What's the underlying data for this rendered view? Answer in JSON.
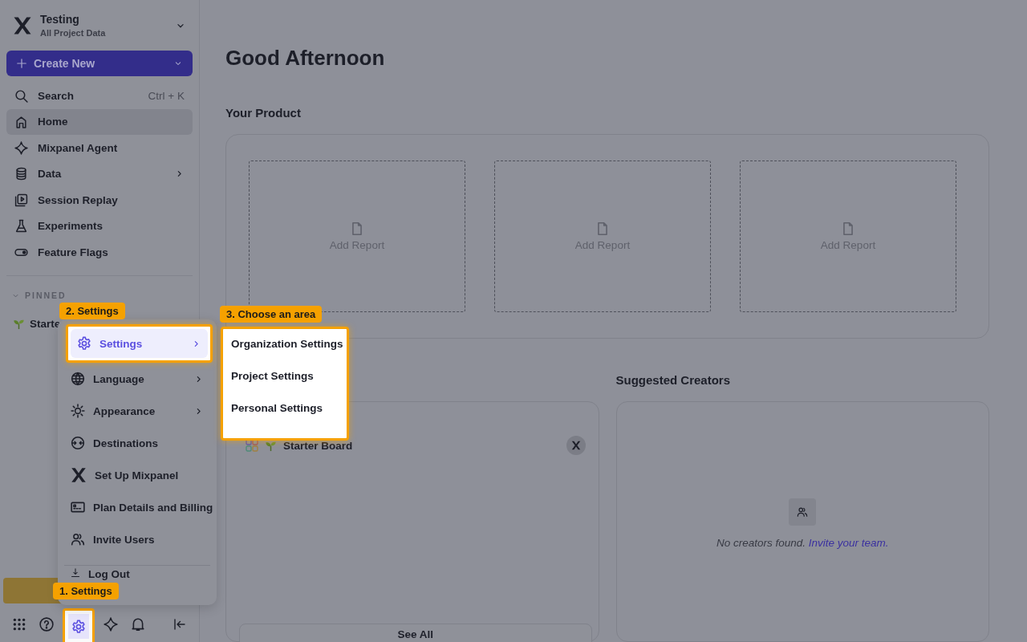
{
  "workspace": {
    "name": "Testing",
    "subtitle": "All Project Data"
  },
  "create_button": {
    "label": "Create New"
  },
  "nav": [
    {
      "label": "Search",
      "shortcut": "Ctrl + K",
      "selected": false
    },
    {
      "label": "Home",
      "selected": true
    },
    {
      "label": "Mixpanel Agent",
      "selected": false
    },
    {
      "label": "Data",
      "has_submenu": true,
      "selected": false
    },
    {
      "label": "Session Replay",
      "selected": false
    },
    {
      "label": "Experiments",
      "selected": false
    },
    {
      "label": "Feature Flags",
      "selected": false
    }
  ],
  "pinned": {
    "heading": "PINNED",
    "expanded": true,
    "items": [
      {
        "label": "Starte"
      }
    ]
  },
  "toolbar": [
    {
      "selected": false
    },
    {
      "selected": false
    },
    {
      "selected": true
    },
    {
      "selected": false
    },
    {
      "selected": false
    }
  ],
  "main": {
    "greeting": "Good Afternoon",
    "product": {
      "title": "Your Product",
      "slots": [
        {
          "label": "Add Report"
        },
        {
          "label": "Add Report"
        },
        {
          "label": "Add Report"
        }
      ]
    },
    "boards": {
      "item": "Starter Board",
      "footer": "See All"
    },
    "creators": {
      "title": "Suggested Creators",
      "empty_text": "No creators found.",
      "link": "Invite your team."
    }
  },
  "menu": {
    "items": [
      {
        "label": "Settings",
        "has_submenu": true,
        "selected": true
      },
      {
        "label": "Language",
        "has_submenu": true,
        "selected": false
      },
      {
        "label": "Appearance",
        "has_submenu": true,
        "selected": false
      },
      {
        "label": "Destinations",
        "selected": false
      },
      {
        "label": "Set Up Mixpanel",
        "selected": false
      },
      {
        "label": "Plan Details and Billing",
        "selected": false
      },
      {
        "label": "Invite Users",
        "selected": false
      }
    ],
    "footer": {
      "label": "Log Out"
    }
  },
  "submenu": {
    "items": [
      {
        "label": "Organization Settings"
      },
      {
        "label": "Project Settings"
      },
      {
        "label": "Personal Settings"
      }
    ]
  },
  "callouts": [
    {
      "text": "2. Settings"
    },
    {
      "text": "3. Choose an area"
    },
    {
      "text": "1. Settings"
    }
  ]
}
